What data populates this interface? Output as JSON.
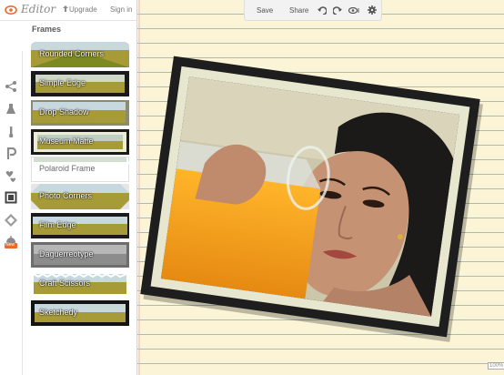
{
  "app": {
    "name": "Editor"
  },
  "account": {
    "upgrade": "Upgrade",
    "sign_in": "Sign in"
  },
  "panel": {
    "title": "Frames"
  },
  "frames": [
    {
      "label": "Rounded Corners"
    },
    {
      "label": "Simple Edge"
    },
    {
      "label": "Drop Shadow"
    },
    {
      "label": "Museum Matte"
    },
    {
      "label": "Polaroid Frame"
    },
    {
      "label": "Photo Corners"
    },
    {
      "label": "Film Edge"
    },
    {
      "label": "Daguerreotype"
    },
    {
      "label": "Craft Scissors"
    },
    {
      "label": "Sketchedy"
    }
  ],
  "selected_frame": "Polaroid Frame",
  "toolbar": {
    "save": "Save",
    "share": "Share"
  },
  "rail": {
    "new_badge": "New"
  },
  "canvas": {
    "badge": "100%"
  },
  "colors": {
    "paper": "#fbf4d6",
    "paper_lines": "#a8b7c9",
    "frame_border": "#1e1e1e",
    "matte": "#e7e7cf",
    "accent_orange": "#e86a2c"
  },
  "icons": {
    "logo": "eye-logo-icon",
    "undo": "undo-icon",
    "redo": "redo-icon",
    "view": "eye-icon",
    "settings": "gear-icon"
  }
}
